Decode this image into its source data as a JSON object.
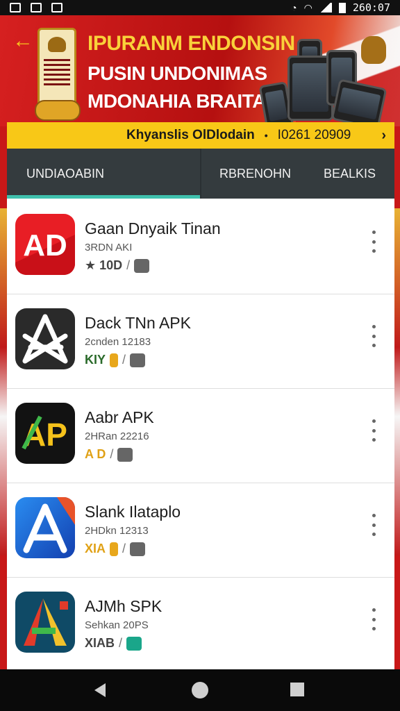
{
  "status_bar": {
    "time": "260:07"
  },
  "banner": {
    "line1": "IPURANM ENDONSIN",
    "line2": "PUSIN UNDONIMAS",
    "line3": "MDONAHIA BRAITA"
  },
  "info_bar": {
    "left_text": "Khyanslis  OlDlodain",
    "right_text": "I0261 20909",
    "chevron": "›"
  },
  "tabs": [
    {
      "label": "UNDIAOABIN"
    },
    {
      "label": "RBRENOHN"
    },
    {
      "label": "BEALKIS"
    }
  ],
  "apps": [
    {
      "title": "Gaan Dnyaik Tinan",
      "subtitle": "3RDN AKI",
      "meta": "★ 10D",
      "meta_color": "#444444",
      "icon_name": "ad-red-app-icon",
      "icon_letters": "AD",
      "icon_bg": "#e81e25",
      "icon_fg": "#ffffff"
    },
    {
      "title": "Dack TNn APK",
      "subtitle": "2cnden 12183",
      "meta": "KIY",
      "meta_color": "#2a6a2a",
      "icon_name": "a-star-dark-app-icon",
      "icon_letters": "A",
      "icon_bg": "#2a2a2a",
      "icon_fg": "#ffffff"
    },
    {
      "title": "Aabr APK",
      "subtitle": "2HRan 22216",
      "meta": "A D",
      "meta_color": "#e0a116",
      "icon_name": "ap-yellow-app-icon",
      "icon_letters": "AP",
      "icon_bg": "#121212",
      "icon_fg": "#f5c21b"
    },
    {
      "title": "Slank Ilataplo",
      "subtitle": "2HDkn 12313",
      "meta": "XIA",
      "meta_color": "#e0a116",
      "icon_name": "a-blue-app-icon",
      "icon_letters": "A",
      "icon_bg": "#1d6fe0",
      "icon_fg": "#ffffff"
    },
    {
      "title": "AJMh SPK",
      "subtitle": "Sehkan 20PS",
      "meta": "XIAB",
      "meta_color": "#444444",
      "icon_name": "a-multicolor-app-icon",
      "icon_letters": "A",
      "icon_bg": "#0f4a66",
      "icon_fg": "#f2c12c"
    }
  ]
}
